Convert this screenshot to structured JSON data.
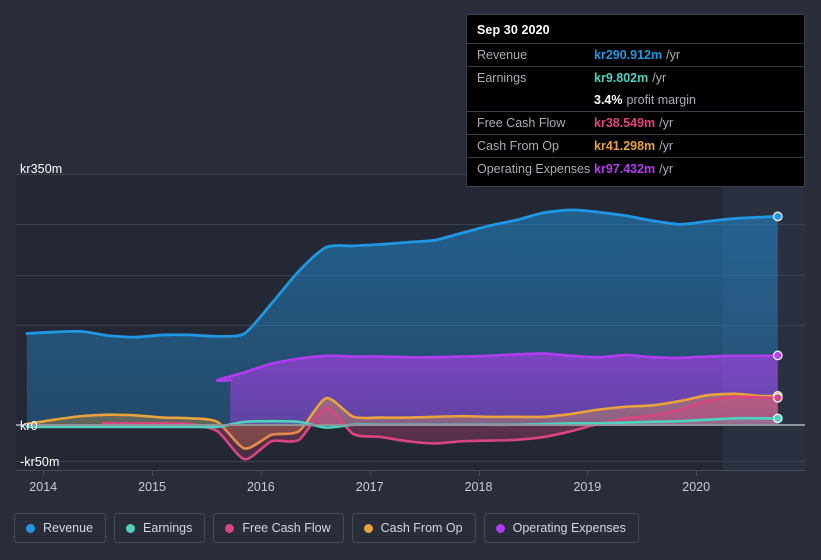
{
  "axes": {
    "y_labels": [
      {
        "text": "kr350m",
        "y": 162
      },
      {
        "text": "kr0",
        "y": 419
      },
      {
        "text": "-kr50m",
        "y": 455
      }
    ],
    "x_labels": [
      "2014",
      "2015",
      "2016",
      "2017",
      "2018",
      "2019",
      "2020"
    ]
  },
  "tooltip": {
    "date": "Sep 30 2020",
    "rows": [
      {
        "label": "Revenue",
        "value": "kr290.912m",
        "unit": "/yr",
        "color": "#2196e3"
      },
      {
        "label": "Earnings",
        "value": "kr9.802m",
        "unit": "/yr",
        "color": "#4fd1c0"
      },
      {
        "label": "",
        "value": "3.4%",
        "unit": "profit margin",
        "color": "#ffffff"
      },
      {
        "label": "Free Cash Flow",
        "value": "kr38.549m",
        "unit": "/yr",
        "color": "#e0447c"
      },
      {
        "label": "Cash From Op",
        "value": "kr41.298m",
        "unit": "/yr",
        "color": "#e8a33d"
      },
      {
        "label": "Operating Expenses",
        "value": "kr97.432m",
        "unit": "/yr",
        "color": "#b23df0"
      }
    ]
  },
  "legend": {
    "items": [
      {
        "label": "Revenue",
        "color": "#2196e3"
      },
      {
        "label": "Earnings",
        "color": "#4fd1c0"
      },
      {
        "label": "Free Cash Flow",
        "color": "#d9457f"
      },
      {
        "label": "Cash From Op",
        "color": "#e8a33d"
      },
      {
        "label": "Operating Expenses",
        "color": "#b23df0"
      }
    ]
  },
  "chart_data": {
    "type": "area",
    "title": "",
    "xlabel": "",
    "ylabel": "",
    "currency": "kr",
    "units": "m",
    "xlim": [
      2013.75,
      2021.0
    ],
    "ylim": [
      -62,
      350
    ],
    "grid": true,
    "legend_position": "bottom",
    "y_ticks": [
      350,
      0,
      -50
    ],
    "x_ticks": [
      2014,
      2015,
      2016,
      2017,
      2018,
      2019,
      2020
    ],
    "forecast_start": 2020.25,
    "x": [
      2013.85,
      2014.1,
      2014.35,
      2014.6,
      2014.85,
      2015.1,
      2015.35,
      2015.6,
      2015.85,
      2016.1,
      2016.35,
      2016.6,
      2016.85,
      2017.1,
      2017.35,
      2017.6,
      2017.85,
      2018.1,
      2018.35,
      2018.6,
      2018.85,
      2019.1,
      2019.35,
      2019.6,
      2019.85,
      2020.1,
      2020.35,
      2020.6,
      2020.75
    ],
    "series": [
      {
        "name": "Revenue",
        "color": "#2196e3",
        "values": [
          128,
          130,
          131,
          125,
          123,
          126,
          126,
          124,
          128,
          170,
          215,
          248,
          250,
          252,
          255,
          258,
          268,
          278,
          286,
          296,
          300,
          297,
          292,
          285,
          280,
          284,
          288,
          290,
          290.912
        ]
      },
      {
        "name": "Operating Expenses",
        "color": "#b23df0",
        "start_x": 2015.72,
        "values": [
          null,
          null,
          null,
          null,
          null,
          null,
          null,
          63,
          74,
          86,
          93,
          97,
          96,
          96,
          95,
          95,
          96,
          97,
          99,
          100,
          97,
          95,
          98,
          95,
          94,
          96,
          97,
          97,
          97.432
        ]
      },
      {
        "name": "Cash From Op",
        "color": "#e8a33d",
        "values": [
          2,
          8,
          13,
          15,
          14,
          11,
          10,
          5,
          -32,
          -13,
          -8,
          38,
          12,
          11,
          11,
          12,
          13,
          12,
          12,
          12,
          16,
          22,
          26,
          28,
          34,
          42,
          44,
          41,
          41.298
        ]
      },
      {
        "name": "Free Cash Flow",
        "color": "#d9457f",
        "start_x": 2014.55,
        "values": [
          null,
          null,
          null,
          3,
          3,
          3,
          2,
          -8,
          -47,
          -22,
          -20,
          25,
          -12,
          -16,
          -22,
          -25,
          -22,
          -21,
          -20,
          -16,
          -8,
          2,
          10,
          14,
          22,
          34,
          40,
          39,
          38.549
        ]
      },
      {
        "name": "Earnings",
        "color": "#4fd1c0",
        "values": [
          -2,
          -2,
          -2,
          -2,
          -2,
          -2,
          -2,
          -2,
          5,
          6,
          5,
          -3,
          1,
          1,
          1,
          1,
          1,
          1,
          1,
          2,
          3,
          3,
          4,
          5,
          6,
          8,
          10,
          10,
          9.802
        ]
      }
    ]
  }
}
